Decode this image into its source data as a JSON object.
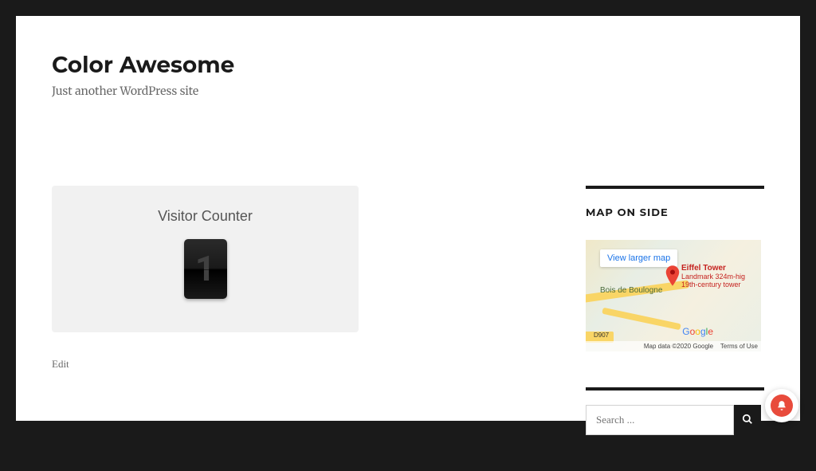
{
  "site": {
    "title": "Color Awesome",
    "description": "Just another WordPress site"
  },
  "visitor_counter": {
    "title": "Visitor Counter",
    "count": "1"
  },
  "edit_link": "Edit",
  "sidebar": {
    "map_widget": {
      "title": "MAP ON SIDE",
      "view_larger": "View larger map",
      "marker_title": "Eiffel Tower",
      "marker_subtitle": "Landmark 324m-hig\n19th-century tower",
      "place_label": "Bois de\nBoulogne",
      "road_label": "D907",
      "attribution": "Map data ©2020 Google",
      "terms": "Terms of Use"
    },
    "search": {
      "placeholder": "Search ..."
    }
  }
}
